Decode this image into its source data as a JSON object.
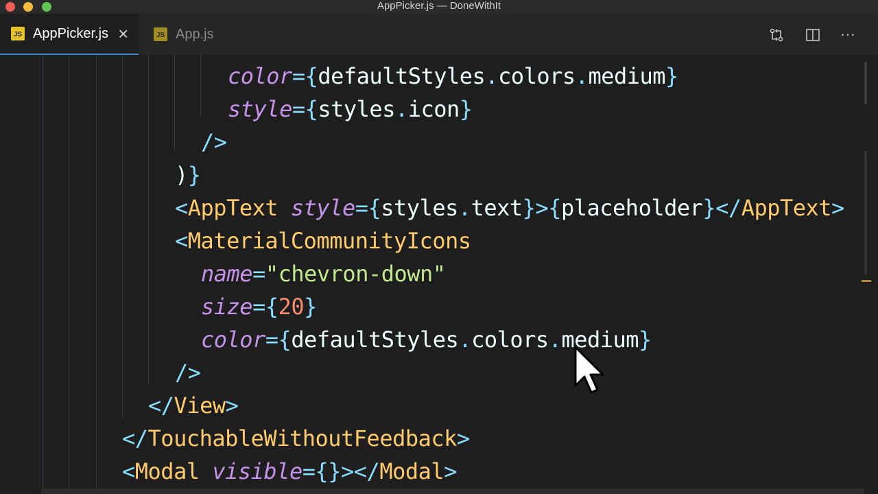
{
  "window": {
    "title": "AppPicker.js — DoneWithIt"
  },
  "tabs": [
    {
      "label": "AppPicker.js",
      "icon": "JS",
      "active": true
    },
    {
      "label": "App.js",
      "icon": "JS",
      "active": false
    }
  ],
  "toolbar": {
    "compare_icon": "compare-changes-icon",
    "split_icon": "split-editor-icon",
    "more_label": "···"
  },
  "code": {
    "l1": {
      "attr": "color",
      "eq": "=",
      "ob": "{",
      "a": "defaultStyles",
      "d1": ".",
      "b": "colors",
      "d2": ".",
      "c": "medium",
      "cb": "}"
    },
    "l2": {
      "attr": "style",
      "eq": "=",
      "ob": "{",
      "a": "styles",
      "d1": ".",
      "b": "icon",
      "cb": "}"
    },
    "l3": {
      "close": "/>"
    },
    "l4": {
      "p": ")",
      "cb": "}"
    },
    "l5": {
      "lt": "<",
      "tag": "AppText",
      "sp": " ",
      "attr": "style",
      "eq": "=",
      "ob": "{",
      "a": "styles",
      "d": ".",
      "b": "text",
      "cb": "}",
      "gt": ">",
      "ob2": "{",
      "c": "placeholder",
      "cb2": "}",
      "lt2": "</",
      "tag2": "AppText",
      "gt2": ">"
    },
    "l6": {
      "lt": "<",
      "tag": "MaterialCommunityIcons"
    },
    "l7": {
      "attr": "name",
      "eq": "=",
      "q1": "\"",
      "str": "chevron-down",
      "q2": "\""
    },
    "l8": {
      "attr": "size",
      "eq": "=",
      "ob": "{",
      "num": "20",
      "cb": "}"
    },
    "l9": {
      "attr": "color",
      "eq": "=",
      "ob": "{",
      "a": "defaultStyles",
      "d1": ".",
      "b": "colors",
      "d2": ".",
      "c": "medium",
      "cb": "}"
    },
    "l10": {
      "close": "/>"
    },
    "l11": {
      "lt": "</",
      "tag": "View",
      "gt": ">"
    },
    "l12": {
      "lt": "</",
      "tag": "TouchableWithoutFeedback",
      "gt": ">"
    },
    "l13": {
      "lt": "<",
      "tag": "Modal",
      "sp": " ",
      "attr": "visible",
      "eq": "=",
      "ob": "{",
      "cb": "}",
      "gt": ">",
      "lt2": "</",
      "tag2": "Modal",
      "gt2": ">"
    }
  },
  "colors": {
    "background": "#1e1e1e",
    "attribute": "#c792ea",
    "punctuation": "#89ddff",
    "tag": "#ffcb6b",
    "string": "#c3e88d",
    "number": "#f78c6c",
    "active_tab_border": "#3b82c4"
  }
}
